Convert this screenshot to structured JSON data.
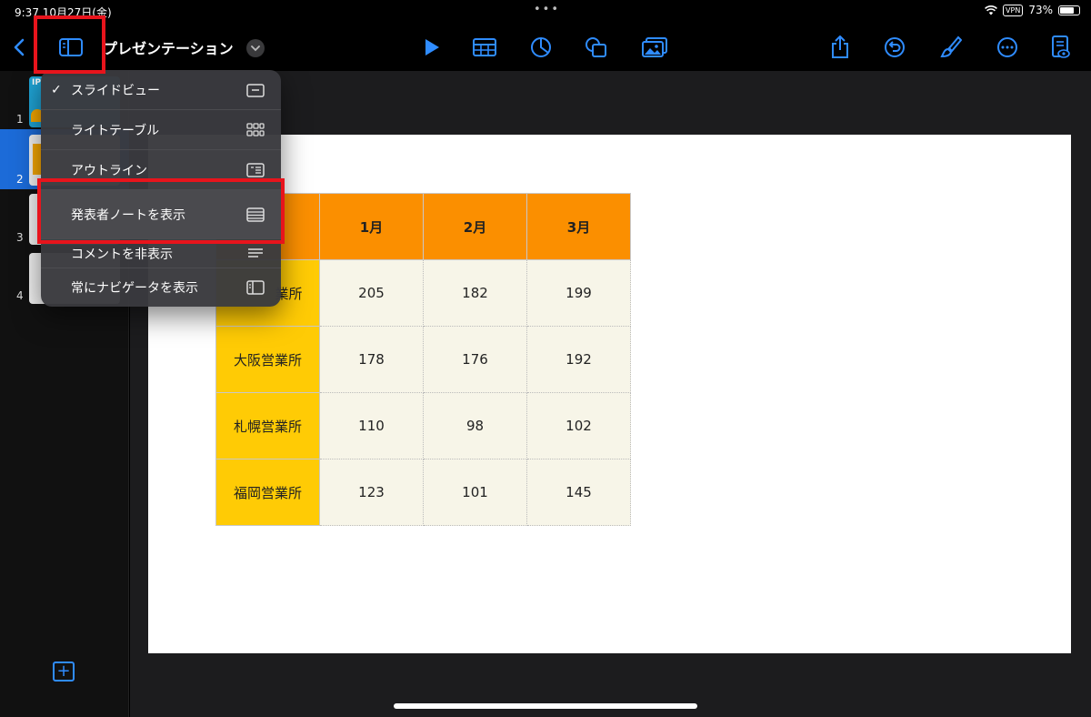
{
  "status": {
    "time": "9:37 10月27日(金)",
    "vpn": "VPN",
    "battery": "73%"
  },
  "toolbar": {
    "title": "プレゼンテーション"
  },
  "sidebar": {
    "slides": [
      {
        "number": "1",
        "badge": "IP"
      },
      {
        "number": "2"
      },
      {
        "number": "3"
      },
      {
        "number": "4"
      }
    ],
    "add_label": "+"
  },
  "menu": {
    "items": [
      {
        "label": "スライドビュー",
        "checked": true,
        "icon": "slide-view-icon"
      },
      {
        "label": "ライトテーブル",
        "checked": false,
        "icon": "grid-icon"
      },
      {
        "label": "アウトライン",
        "checked": false,
        "icon": "outline-icon"
      },
      {
        "label": "発表者ノートを表示",
        "checked": false,
        "icon": "notes-icon"
      },
      {
        "label": "コメントを非表示",
        "checked": false,
        "icon": "comments-icon"
      },
      {
        "label": "常にナビゲータを表示",
        "checked": false,
        "icon": "sidebar-icon"
      }
    ],
    "check_mark": "✓"
  },
  "table": {
    "columns": [
      "1月",
      "2月",
      "3月"
    ],
    "rows": [
      {
        "label": "東京営業所",
        "visible_label": "業所",
        "values": [
          "205",
          "182",
          "199"
        ]
      },
      {
        "label": "大阪営業所",
        "values": [
          "178",
          "176",
          "192"
        ]
      },
      {
        "label": "札幌営業所",
        "values": [
          "110",
          "98",
          "102"
        ]
      },
      {
        "label": "福岡営業所",
        "values": [
          "123",
          "101",
          "145"
        ]
      }
    ]
  },
  "colors": {
    "accent": "#2f8cff",
    "highlight": "#e8141c",
    "header_orange": "#fb8f00",
    "row_yellow": "#ffcb05",
    "cell_bg": "#f7f5e8"
  }
}
